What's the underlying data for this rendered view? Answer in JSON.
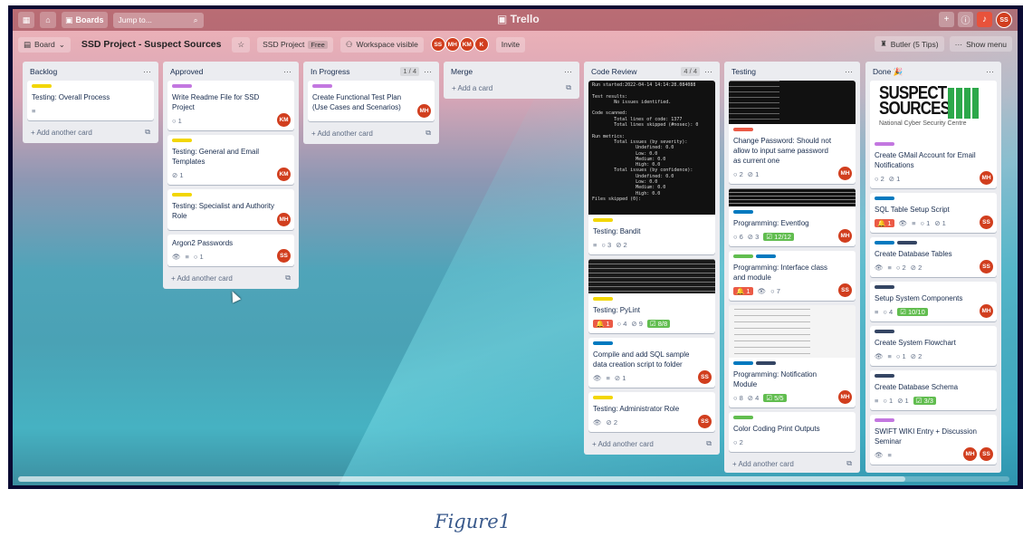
{
  "topnav": {
    "boards_label": "Boards",
    "jump_placeholder": "Jump to...",
    "logo": "Trello",
    "user_initials": "SS"
  },
  "boardbar": {
    "view_label": "Board",
    "title": "SSD Project - Suspect Sources",
    "workspace_label": "SSD Project",
    "plan_badge": "Free",
    "visibility_label": "Workspace visible",
    "members": [
      "SS",
      "MH",
      "KM",
      "K"
    ],
    "invite_label": "Invite",
    "butler_label": "Butler (5 Tips)",
    "show_menu_label": "Show menu"
  },
  "add_card_label": "Add another card",
  "add_a_card_label": "Add a card",
  "lists": [
    {
      "name": "Backlog",
      "count": "",
      "cards": [
        {
          "title": "Testing: Overall Process",
          "labels": [
            "#f2d600"
          ],
          "badges": [
            "desc"
          ],
          "members": []
        }
      ]
    },
    {
      "name": "Approved",
      "count": "",
      "cards": [
        {
          "title": "Write Readme File for SSD Project",
          "labels": [
            "#c377e0"
          ],
          "badges": [
            "c:1"
          ],
          "members": [
            "KM"
          ]
        },
        {
          "title": "Testing: General and Email Templates",
          "labels": [
            "#f2d600"
          ],
          "badges": [
            "a:1"
          ],
          "members": [
            "KM"
          ]
        },
        {
          "title": "Testing: Specialist and Authority Role",
          "labels": [
            "#f2d600"
          ],
          "badges": [],
          "members": [
            "MH"
          ]
        },
        {
          "title": "Argon2 Passwords",
          "labels": [],
          "badges": [
            "w",
            "desc",
            "c:1"
          ],
          "members": [
            "SS"
          ]
        }
      ]
    },
    {
      "name": "In Progress",
      "count": "1 / 4",
      "cards": [
        {
          "title": "Create Functional Test Plan (Use Cases and Scenarios)",
          "labels": [
            "#c377e0"
          ],
          "badges": [],
          "members": [
            "MH"
          ]
        }
      ]
    },
    {
      "name": "Merge",
      "count": "",
      "cards": []
    },
    {
      "name": "Code Review",
      "count": "4 / 4",
      "cards": [
        {
          "title": "Testing: Bandit",
          "labels": [
            "#f2d600"
          ],
          "badges": [
            "desc",
            "c:3",
            "a:2"
          ],
          "members": [],
          "cover": "terminal1"
        },
        {
          "title": "Testing: PyLint",
          "labels": [
            "#f2d600"
          ],
          "badges": [
            "r:1",
            "c:4",
            "a:9",
            "g:8/8"
          ],
          "members": [],
          "cover": "terminal2"
        },
        {
          "title": "Compile and add SQL sample data creation script to folder",
          "labels": [
            "#0079bf"
          ],
          "badges": [
            "w",
            "desc",
            "a:1"
          ],
          "members": [
            "SS"
          ]
        },
        {
          "title": "Testing: Administrator Role",
          "labels": [
            "#f2d600"
          ],
          "badges": [
            "w",
            "a:2"
          ],
          "members": [
            "SS"
          ]
        }
      ]
    },
    {
      "name": "Testing",
      "count": "",
      "cards": [
        {
          "title": "Change Password: Should not allow to input same password as current one",
          "labels": [
            "#eb5a46"
          ],
          "badges": [
            "c:2",
            "a:1"
          ],
          "members": [
            "MH"
          ],
          "cover": "terminal3"
        },
        {
          "title": "Programming: Eventlog",
          "labels": [
            "#0079bf"
          ],
          "badges": [
            "c:6",
            "a:3",
            "g:12/12"
          ],
          "members": [
            "MH"
          ],
          "cover": "terminal4"
        },
        {
          "title": "Programming: Interface class and module",
          "labels": [
            "#61bd4f",
            "#0079bf"
          ],
          "badges": [
            "r:1",
            "w",
            "c:7"
          ],
          "members": [
            "SS"
          ]
        },
        {
          "title": "Programming: Notification Module",
          "labels": [
            "#0079bf",
            "#344563"
          ],
          "badges": [
            "c:8",
            "a:4",
            "g:5/5"
          ],
          "members": [
            "MH"
          ],
          "cover": "doc"
        },
        {
          "title": "Color Coding Print Outputs",
          "labels": [
            "#61bd4f"
          ],
          "badges": [
            "c:2"
          ],
          "members": []
        }
      ]
    },
    {
      "name": "Done 🎉",
      "count": "",
      "cards": [
        {
          "title": "Create GMail Account for Email Notifications",
          "labels": [
            "#c377e0"
          ],
          "badges": [
            "c:2",
            "a:1"
          ],
          "members": [
            "MH"
          ],
          "cover": "logo"
        },
        {
          "title": "SQL Table Setup Script",
          "labels": [
            "#0079bf"
          ],
          "badges": [
            "r:1",
            "w",
            "desc",
            "c:1",
            "a:1"
          ],
          "members": [
            "SS"
          ]
        },
        {
          "title": "Create Database Tables",
          "labels": [
            "#0079bf",
            "#344563"
          ],
          "badges": [
            "w",
            "desc",
            "c:2",
            "a:2"
          ],
          "members": [
            "SS"
          ]
        },
        {
          "title": "Setup System Components",
          "labels": [
            "#344563"
          ],
          "badges": [
            "desc",
            "c:4",
            "g:10/10"
          ],
          "members": [
            "MH"
          ]
        },
        {
          "title": "Create System Flowchart",
          "labels": [
            "#344563"
          ],
          "badges": [
            "w",
            "desc",
            "c:1",
            "a:2"
          ],
          "members": []
        },
        {
          "title": "Create Database Schema",
          "labels": [
            "#344563"
          ],
          "badges": [
            "desc",
            "c:1",
            "a:1",
            "g:3/3"
          ],
          "members": []
        },
        {
          "title": "SWIFT WIKI Entry + Discussion Seminar",
          "labels": [
            "#c377e0"
          ],
          "badges": [
            "w",
            "desc"
          ],
          "members": [
            "MH",
            "SS"
          ]
        }
      ]
    }
  ],
  "logo_card": {
    "line1": "SUSPECT",
    "line2": "SOURCES",
    "subtitle": "National Cyber Security Centre"
  },
  "terminal1": "Run started:2022-04-14 14:14:28.084088\n\nTest results:\n        No issues identified.\n\nCode scanned:\n        Total lines of code: 1377\n        Total lines skipped (#nosec): 0\n\nRun metrics:\n        Total issues (by severity):\n                Undefined: 0.0\n                Low: 0.0\n                Medium: 0.0\n                High: 0.0\n        Total issues (by confidence):\n                Undefined: 0.0\n                Low: 0.0\n                Medium: 0.0\n                High: 0.0\nFiles skipped (0):",
  "caption": "Figure1"
}
